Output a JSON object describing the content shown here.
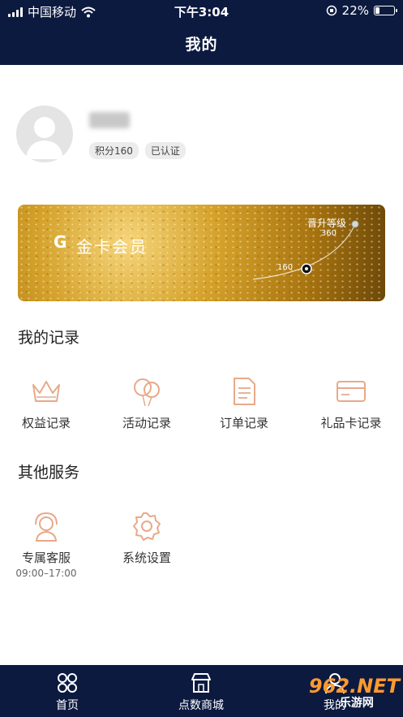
{
  "status": {
    "carrier": "中国移动",
    "time": "下午3:04",
    "battery": "22%"
  },
  "header": {
    "title": "我的"
  },
  "profile": {
    "points_tag": "积分160",
    "verified_tag": "已认证"
  },
  "card": {
    "title": "金卡会员",
    "upgrade": "晋升等级",
    "next_points": "360",
    "current_points": "160"
  },
  "records": {
    "title": "我的记录",
    "items": [
      {
        "label": "权益记录",
        "icon": "crown-icon"
      },
      {
        "label": "活动记录",
        "icon": "balloon-icon"
      },
      {
        "label": "订单记录",
        "icon": "document-icon"
      },
      {
        "label": "礼品卡记录",
        "icon": "card-icon"
      }
    ]
  },
  "services": {
    "title": "其他服务",
    "items": [
      {
        "label": "专属客服",
        "sub": "09:00–17:00",
        "icon": "headset-icon"
      },
      {
        "label": "系统设置",
        "icon": "gear-icon"
      }
    ]
  },
  "tabbar": {
    "items": [
      {
        "label": "首页",
        "icon": "home-grid-icon"
      },
      {
        "label": "点数商城",
        "icon": "store-icon"
      },
      {
        "label": "我的",
        "icon": "user-icon"
      }
    ]
  },
  "watermark": {
    "text": "962.NET",
    "sub": "乐游网"
  },
  "colors": {
    "navy": "#0c1a40",
    "icon_accent": "#e8a98a",
    "gold": "#d4a12a"
  }
}
